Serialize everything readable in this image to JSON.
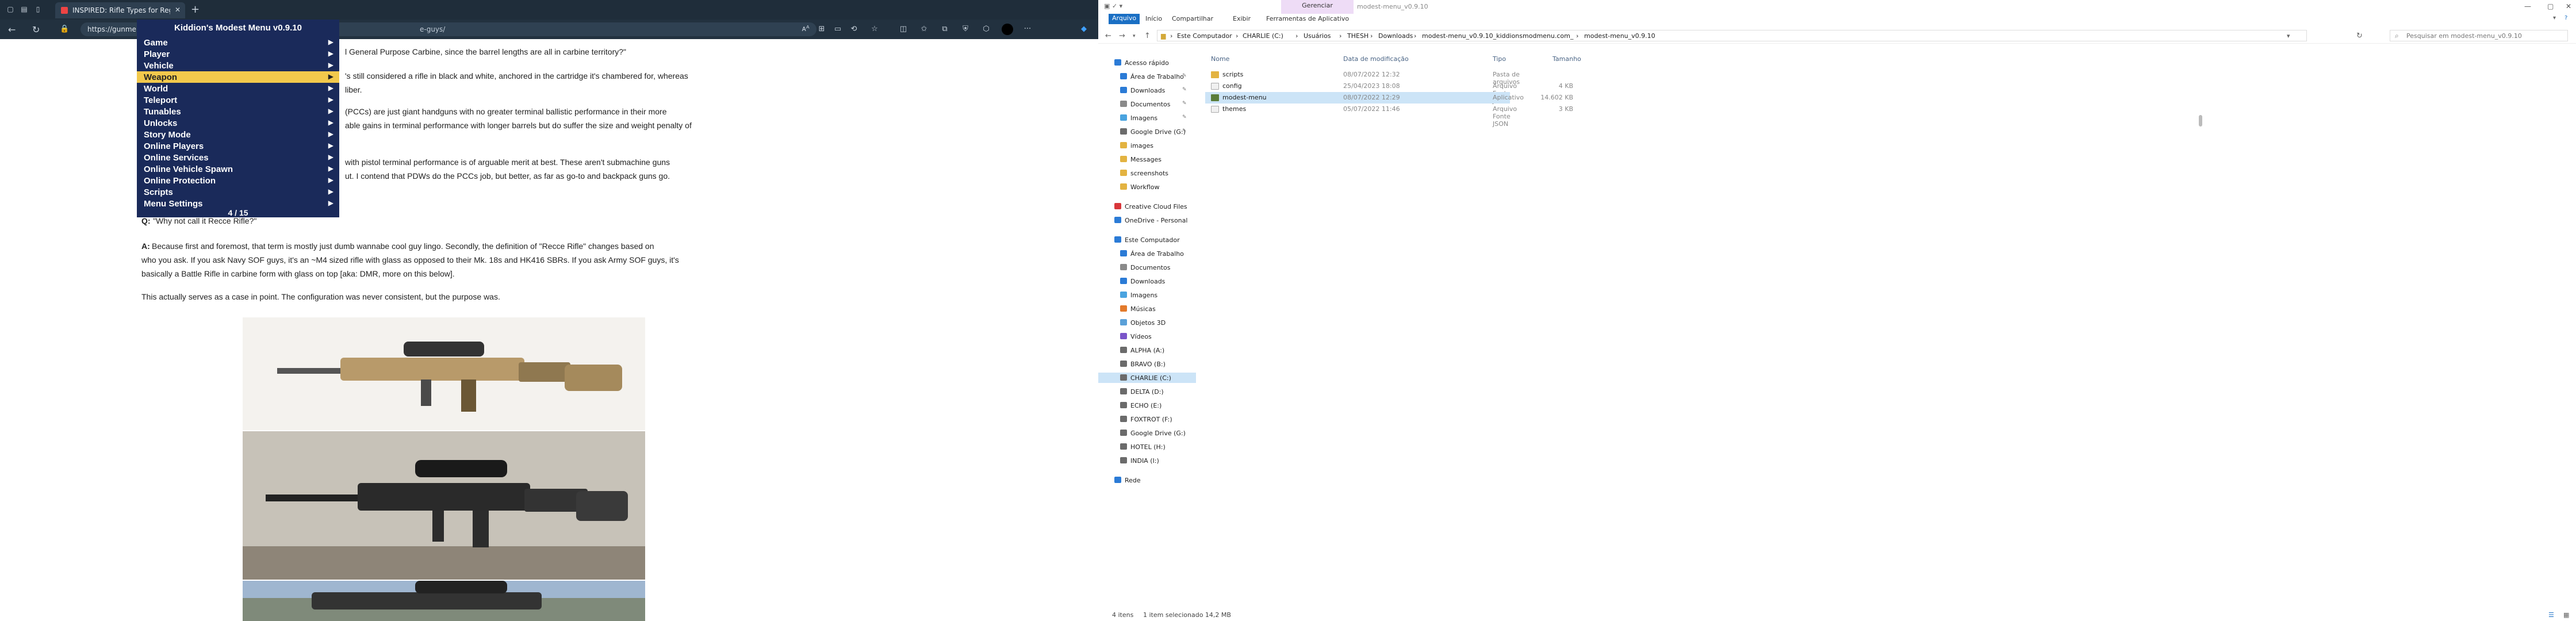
{
  "browser": {
    "tab_title": "INSPIRED: Rifle Types for Regula",
    "url_start": "https://gunme",
    "url_end": "e-guys/",
    "article": {
      "line1": "l General Purpose Carbine, since the barrel lengths are all in carbine territory?\"",
      "line2": "'s still considered a rifle in black and white, anchored in the cartridge it's chambered for, whereas",
      "line3": "liber.",
      "line4": "(PCCs) are just giant handguns with no greater terminal ballistic performance in their more",
      "line5": "able gains in terminal performance with longer barrels but do suffer the size and weight penalty of",
      "line6": "with pistol terminal performance is of arguable merit at best. These aren't submachine guns",
      "line7": "ut. I contend that PDWs do the PCCs job, but better, as far as go-to and backpack guns go.",
      "q_label": "Q:",
      "q_text": "\"Why not call it Recce Rifle?\"",
      "a_label": "A:",
      "a_line1": "Because first and foremost, that term is mostly just dumb wannabe cool guy lingo. Secondly, the definition of \"Recce Rifle\" changes based on",
      "a_line2": "who you ask. If you ask Navy SOF guys, it's an ~M4 sized rifle with glass as opposed to their Mk. 18s and HK416 SBRs. If you ask Army SOF guys, it's",
      "a_line3": "basically a Battle Rifle in carbine form with glass on top [aka: DMR, more on this below].",
      "p_line": "This actually serves as a case in point. The configuration was never consistent, but the purpose was."
    }
  },
  "mod_menu": {
    "title": "Kiddion's Modest Menu v0.9.10",
    "items": [
      "Game",
      "Player",
      "Vehicle",
      "Weapon",
      "World",
      "Teleport",
      "Tunables",
      "Unlocks",
      "Story Mode",
      "Online Players",
      "Online Services",
      "Online Vehicle Spawn",
      "Online Protection",
      "Scripts",
      "Menu Settings"
    ],
    "selected_index": 3,
    "counter": "4 / 15"
  },
  "explorer": {
    "window_title": "modest-menu_v0.9.10",
    "context_tab": "Gerenciar",
    "ribbon_tabs": [
      "Arquivo",
      "Início",
      "Compartilhar",
      "Exibir",
      "Ferramentas de Aplicativo"
    ],
    "breadcrumbs": [
      "Este Computador",
      "CHARLIE (C:)",
      "Usuários",
      "THESH",
      "Downloads",
      "modest-menu_v0.9.10_kiddionsmodmenu.com_",
      "modest-menu_v0.9.10"
    ],
    "search_placeholder": "Pesquisar em modest-menu_v0.9.10",
    "columns": [
      "Nome",
      "Data de modificação",
      "Tipo",
      "Tamanho"
    ],
    "files": [
      {
        "name": "scripts",
        "date": "08/07/2022 12:32",
        "type": "Pasta de arquivos",
        "size": "",
        "icon": "folder-icon"
      },
      {
        "name": "config",
        "date": "25/04/2023 18:08",
        "type": "Arquivo Fonte JSON",
        "size": "4 KB",
        "icon": "json-file-icon"
      },
      {
        "name": "modest-menu",
        "date": "08/07/2022 12:29",
        "type": "Aplicativo",
        "size": "14.602 KB",
        "icon": "app-icon"
      },
      {
        "name": "themes",
        "date": "05/07/2022 11:46",
        "type": "Arquivo Fonte JSON",
        "size": "3 KB",
        "icon": "json-file-icon"
      }
    ],
    "selected_file": 2,
    "nav": [
      {
        "label": "Acesso rápido",
        "indent": 0,
        "icon": "star-icon",
        "pin": false
      },
      {
        "label": "Área de Trabalho",
        "indent": 1,
        "icon": "desktop-icon",
        "pin": true
      },
      {
        "label": "Downloads",
        "indent": 1,
        "icon": "download-icon",
        "pin": true
      },
      {
        "label": "Documentos",
        "indent": 1,
        "icon": "document-icon",
        "pin": true
      },
      {
        "label": "Imagens",
        "indent": 1,
        "icon": "image-icon",
        "pin": true
      },
      {
        "label": "Google Drive (G:)",
        "indent": 1,
        "icon": "drive-icon",
        "pin": true
      },
      {
        "label": "images",
        "indent": 1,
        "icon": "folder-icon",
        "pin": false
      },
      {
        "label": "Messages",
        "indent": 1,
        "icon": "folder-icon",
        "pin": false
      },
      {
        "label": "screenshots",
        "indent": 1,
        "icon": "folder-icon",
        "pin": false
      },
      {
        "label": "Workflow",
        "indent": 1,
        "icon": "folder-icon",
        "pin": false
      },
      {
        "label": "Creative Cloud Files",
        "indent": 0,
        "icon": "cloud-icon",
        "pin": false
      },
      {
        "label": "OneDrive - Personal",
        "indent": 0,
        "icon": "onedrive-icon",
        "pin": false
      },
      {
        "label": "Este Computador",
        "indent": 0,
        "icon": "computer-icon",
        "pin": false
      },
      {
        "label": "Área de Trabalho",
        "indent": 1,
        "icon": "desktop-icon",
        "pin": false
      },
      {
        "label": "Documentos",
        "indent": 1,
        "icon": "document-icon",
        "pin": false
      },
      {
        "label": "Downloads",
        "indent": 1,
        "icon": "download-icon",
        "pin": false
      },
      {
        "label": "Imagens",
        "indent": 1,
        "icon": "image-icon",
        "pin": false
      },
      {
        "label": "Músicas",
        "indent": 1,
        "icon": "music-icon",
        "pin": false
      },
      {
        "label": "Objetos 3D",
        "indent": 1,
        "icon": "cube-icon",
        "pin": false
      },
      {
        "label": "Vídeos",
        "indent": 1,
        "icon": "video-icon",
        "pin": false
      },
      {
        "label": "ALPHA (A:)",
        "indent": 1,
        "icon": "drive-icon",
        "pin": false
      },
      {
        "label": "BRAVO (B:)",
        "indent": 1,
        "icon": "drive-icon",
        "pin": false
      },
      {
        "label": "CHARLIE (C:)",
        "indent": 1,
        "icon": "drive-icon",
        "pin": false
      },
      {
        "label": "DELTA (D:)",
        "indent": 1,
        "icon": "drive-icon",
        "pin": false
      },
      {
        "label": "ECHO (E:)",
        "indent": 1,
        "icon": "drive-icon",
        "pin": false
      },
      {
        "label": "FOXTROT (F:)",
        "indent": 1,
        "icon": "drive-icon",
        "pin": false
      },
      {
        "label": "Google Drive (G:)",
        "indent": 1,
        "icon": "drive-icon",
        "pin": false
      },
      {
        "label": "HOTEL (H:)",
        "indent": 1,
        "icon": "drive-icon",
        "pin": false
      },
      {
        "label": "INDIA (I:)",
        "indent": 1,
        "icon": "drive-icon",
        "pin": false
      },
      {
        "label": "Rede",
        "indent": 0,
        "icon": "network-icon",
        "pin": false
      }
    ],
    "nav_selected": 22,
    "status_count": "4 itens",
    "status_selection": "1 item selecionado  14,2 MB"
  }
}
